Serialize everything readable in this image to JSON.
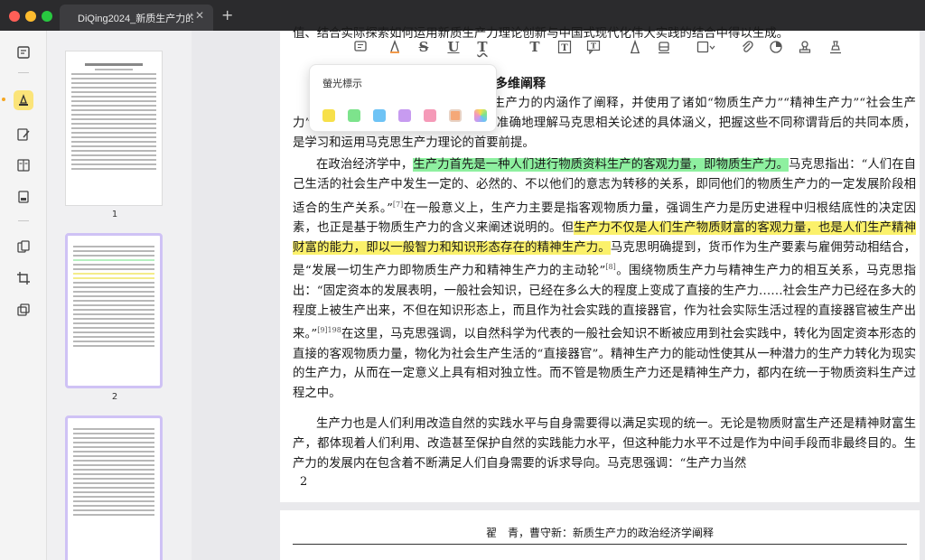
{
  "window": {
    "tab_title": "DiQing2024_新质生产力的",
    "tab_close": "✕",
    "new_tab": "+"
  },
  "colors": {
    "traffic_red": "#ff5f57",
    "traffic_yellow": "#febc2e",
    "traffic_green": "#28c840",
    "rail_active": "#fbe479",
    "highlight_green": "#8ef0a0",
    "highlight_yellow": "#fbf16b"
  },
  "rail": {
    "icons": [
      "reader-icon",
      "highlighter-icon",
      "edit-pdf-icon",
      "form-icon",
      "redact-icon",
      "organize-pages-icon",
      "crop-icon",
      "batch-icon"
    ]
  },
  "thumbnails": {
    "page1_num": "1",
    "page2_num": "2"
  },
  "toolbar": {
    "icons": [
      "comment-icon",
      "highlight-icon",
      "strikethrough-icon",
      "underline-icon",
      "squiggly-underline-icon",
      "text-icon",
      "textbox-icon",
      "text-callout-icon",
      "pencil-icon",
      "eraser-icon",
      "shape-icon",
      "attachment-icon",
      "area-highlight-icon",
      "stamp-icon",
      "signature-icon"
    ],
    "strike_letter": "S",
    "underline_letter": "U",
    "squiggly_letter": "T",
    "text_letter": "T"
  },
  "popup": {
    "title": "螢光標示",
    "swatches": [
      "#f7e04a",
      "#7de38c",
      "#6ec3f5",
      "#c79bf0",
      "#f59ab8",
      "#f5a878"
    ]
  },
  "document": {
    "top_cut_line": "值、结合实际探索如何运用新质生产力理论创新与中国式现代化伟大实践的结合中得以生成。",
    "heading_fragment": "多维阐释",
    "p1_start": "马克思从多个角度、不同侧面对生产力的内涵作了阐释，并使用了诸如“物质生",
    "p1_line2": "产力”“精神生产力”“社会生产力”“直接的生产力”等多种称谓。全面准确地理解马克思相关论述",
    "p1_line3": "的具体涵义，把握这些不同称谓背后的共同本质，是学习和运用马克思生产力理论的首要前提。",
    "p2_a": "在政治经济学中，",
    "p2_hl1": "生产力首先是一种人们进行物质资料生产的客观力量，即物质生产力。",
    "p2_b": "马克思指出：“人们在自己生活的社会生产中发生一定的、必然的、不以他们的意志为转移的关系，即同他们的物质生产力的一定发展阶段相适合的生产关系。”",
    "p2_ref7": "[7]",
    "p2_c": "在一般意义上，生产力主要是指客观物质力量，强调生产力是历史进程中归根结底性的决定因素，也正是基于物质生产力的含义来阐述说明的。但",
    "p2_hl2": "生产力不仅是人们生产物质财富的客观力量，也是人们生产精神财富的能力，即以一般智力和知识形态存在的精神生产力。",
    "p2_d": "马克思明确提到，货币作为生产要素与雇佣劳动相结合，是“发展一切生产力即物质生产力和精神生产力的主动轮”",
    "p2_ref8": "[8]",
    "p2_e": "。围绕物质生产力与精神生产力的相互关系，马克思指出：“固定资本的发展表明，一般社会知识，已经在多么大的程度上变成了直接的生产力……社会生产力已经在多大的程度上被生产出来，不但在知识形态上，而且作为社会实践的直接器官，作为社会实际生活过程的直接器官被生产出来。”",
    "p2_ref9": "[9]198",
    "p2_f": "在这里，马克思强调，以自然科学为代表的一般社会知识不断被应用到社会实践中，转化为固定资本形态的直接的客观物质力量，物化为社会生产生活的“直接器官”。精神生产力的能动性使其从一种潜力的生产力转化为现实的生产力，从而在一定意义上具有相对独立性。而不管是物质生产力还是精神生产力，都内在统一于物质资料生产过程之中。",
    "p3": "生产力也是人们利用改造自然的实践水平与自身需要得以满足实现的统一。无论是物质财富生产还是精神财富生产，都体现着人们利用、改造甚至保护自然的实践能力水平，但这种能力水平不过是作为中间手段而非最终目的。生产力的发展内在包含着不断满足人们自身需要的诉求导向。马克思强调：“生产力当然",
    "page_number": "2",
    "next_page_running_head": "翟　青，曹守新：新质生产力的政治经济学阐释"
  }
}
